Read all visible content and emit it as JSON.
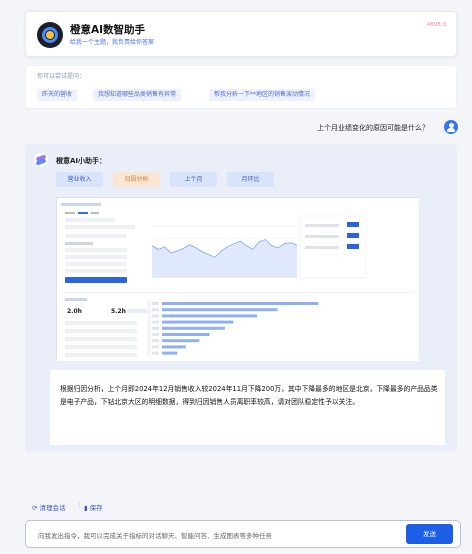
{
  "header": {
    "title": "橙意AI数智助手",
    "subtitle": "给我一个主题，我负责给你答案",
    "badge": "4698.3"
  },
  "suggestions": {
    "label": "你可以尝试提问：",
    "items": [
      "昨天的营收",
      "我想知道哪些品类销售有异常",
      "帮我分析一下**地区的销售波动情况"
    ]
  },
  "user": {
    "question": "上个月业绩变化的原因可能是什么？"
  },
  "assistant": {
    "name": "橙意AI小助手：",
    "tabs": [
      {
        "label": "营业收入"
      },
      {
        "label": "归因分析",
        "active": true
      },
      {
        "label": "上个月"
      },
      {
        "label": "月环比"
      }
    ],
    "answer": "根据归因分析，上个月即2024年12月销售收入较2024年11月下降200万，其中下降最多的地区是北京，下降最多的产品品类是电子产品，下钻北京大区的明细数据，得到归因销售人员离职率较高，请对团队稳定性予以关注。",
    "embedded": {
      "stats": [
        "2.0h",
        "5.2h"
      ],
      "line_values": [
        62,
        55,
        60,
        48,
        52,
        57,
        64,
        58,
        50,
        45,
        40,
        52,
        60,
        66,
        71,
        62,
        55,
        70,
        74,
        62,
        58,
        66,
        68,
        63
      ],
      "bar_values": [
        92,
        68,
        56,
        42,
        37,
        28,
        22,
        14,
        9
      ]
    }
  },
  "toolbar": {
    "clear": "清理会话",
    "save": "保存"
  },
  "input": {
    "placeholder": "向我发出指令，我可以完成关于指标的对话聊天、智能问答、生成图表等多种任务",
    "send": "发送"
  },
  "colors": {
    "primary": "#1c5fe4",
    "accent": "#3677ee",
    "active_tab_bg": "#fbe6d3",
    "active_tab_text": "#d67a2e"
  }
}
